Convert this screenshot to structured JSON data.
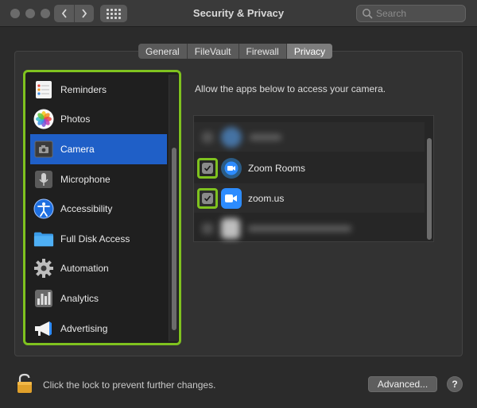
{
  "window": {
    "title": "Security & Privacy",
    "search_placeholder": "Search"
  },
  "tabs": [
    {
      "label": "General",
      "active": false
    },
    {
      "label": "FileVault",
      "active": false
    },
    {
      "label": "Firewall",
      "active": false
    },
    {
      "label": "Privacy",
      "active": true
    }
  ],
  "sidebar": {
    "items": [
      {
        "label": "Reminders",
        "icon": "reminders-icon",
        "selected": false
      },
      {
        "label": "Photos",
        "icon": "photos-icon",
        "selected": false
      },
      {
        "label": "Camera",
        "icon": "camera-icon",
        "selected": true
      },
      {
        "label": "Microphone",
        "icon": "microphone-icon",
        "selected": false
      },
      {
        "label": "Accessibility",
        "icon": "accessibility-icon",
        "selected": false
      },
      {
        "label": "Full Disk Access",
        "icon": "folder-icon",
        "selected": false
      },
      {
        "label": "Automation",
        "icon": "gear-icon",
        "selected": false
      },
      {
        "label": "Analytics",
        "icon": "analytics-icon",
        "selected": false
      },
      {
        "label": "Advertising",
        "icon": "megaphone-icon",
        "selected": false
      }
    ]
  },
  "content": {
    "allow_text": "Allow the apps below to access your camera.",
    "apps": [
      {
        "name": "Zoom Rooms",
        "checked": true,
        "icon": "zoom-rooms-icon"
      },
      {
        "name": "zoom.us",
        "checked": true,
        "icon": "zoom-icon"
      }
    ]
  },
  "footer": {
    "lock_text": "Click the lock to prevent further changes.",
    "advanced_label": "Advanced...",
    "help_label": "?"
  },
  "colors": {
    "accent": "#1f5fc7",
    "highlight": "#7fc21f",
    "zoom_blue": "#2d8cff"
  }
}
